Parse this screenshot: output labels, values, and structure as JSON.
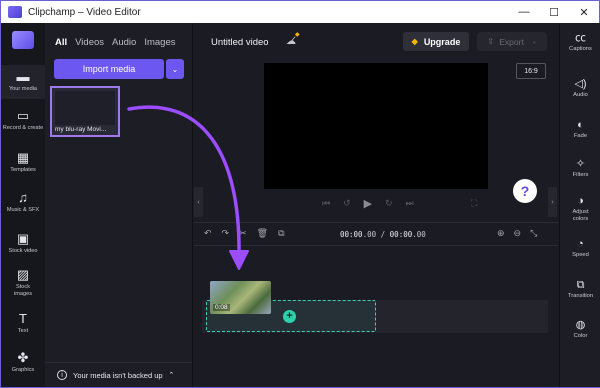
{
  "window": {
    "title": "Clipchamp – Video Editor",
    "controls": [
      "minimize",
      "maximize",
      "close"
    ]
  },
  "left_rail": {
    "items": [
      {
        "label": "Your media",
        "icon": "folder-icon",
        "glyph": "🗀"
      },
      {
        "label": "Record & create",
        "icon": "camera-icon",
        "glyph": "▭"
      },
      {
        "label": "Templates",
        "icon": "templates-icon",
        "glyph": "▦"
      },
      {
        "label": "Music & SFX",
        "icon": "music-icon",
        "glyph": "♫"
      },
      {
        "label": "Stock video",
        "icon": "stock-video-icon",
        "glyph": "▣"
      },
      {
        "label": "Stock images",
        "icon": "stock-images-icon",
        "glyph": "▨"
      },
      {
        "label": "Text",
        "icon": "text-icon",
        "glyph": "T"
      },
      {
        "label": "Graphics",
        "icon": "graphics-icon",
        "glyph": "✤"
      }
    ]
  },
  "media_panel": {
    "tabs": [
      "All",
      "Videos",
      "Audio",
      "Images"
    ],
    "active_tab": "All",
    "import_label": "Import media",
    "media_item_name": "my blu-ray Movi...",
    "backup_text": "Your media isn't backed up"
  },
  "topbar": {
    "project_title": "Untitled video",
    "upgrade_label": "Upgrade",
    "export_label": "Export"
  },
  "preview": {
    "aspect_ratio": "16:9",
    "help_label": "?"
  },
  "timeline": {
    "current_time": "00:00",
    "current_frac": ".00",
    "total_time": "00:00",
    "total_frac": ".00",
    "separator": " / ",
    "clip_duration": "0:08"
  },
  "right_rail": {
    "items": [
      {
        "label": "Captions",
        "icon": "captions-icon",
        "glyph": "㏄"
      },
      {
        "label": "Audio",
        "icon": "audio-icon",
        "glyph": "🔈"
      },
      {
        "label": "Fade",
        "icon": "fade-icon",
        "glyph": "◐"
      },
      {
        "label": "Filters",
        "icon": "filters-icon",
        "glyph": "✧"
      },
      {
        "label": "Adjust colors",
        "icon": "adjust-colors-icon",
        "glyph": "◑"
      },
      {
        "label": "Speed",
        "icon": "speed-icon",
        "glyph": "◔"
      },
      {
        "label": "Transition",
        "icon": "transition-icon",
        "glyph": "⧉"
      },
      {
        "label": "Color",
        "icon": "color-icon",
        "glyph": "◍"
      }
    ]
  },
  "colors": {
    "accent": "#6c57f0",
    "annotation": "#9b4dff",
    "drop_zone": "#3fcfb2"
  }
}
